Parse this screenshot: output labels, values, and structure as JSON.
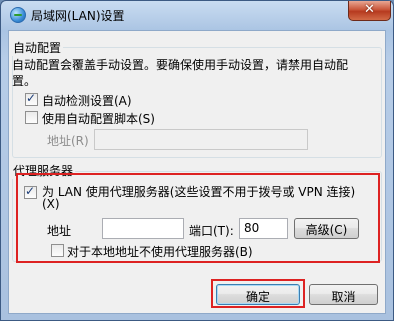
{
  "window": {
    "title": "局域网(LAN)设置",
    "close_label": "✕"
  },
  "auto_config": {
    "group_label": "自动配置",
    "description_line1": "自动配置会覆盖手动设置。要确保使用手动设置，请禁用自动配",
    "description_line2": "置。",
    "auto_detect_label": "自动检测设置(A)",
    "auto_detect_checked": true,
    "use_script_label": "使用自动配置脚本(S)",
    "use_script_checked": false,
    "address_label": "地址(R)",
    "address_value": ""
  },
  "proxy": {
    "group_label": "代理服务器",
    "use_proxy_label_line1": "为 LAN 使用代理服务器(这些设置不用于拨号或 VPN 连接)",
    "use_proxy_label_line2": "(X)",
    "use_proxy_checked": true,
    "address_label": "地址",
    "address_value": "",
    "port_label": "端口(T):",
    "port_value": "80",
    "advanced_label": "高级(C)",
    "bypass_local_label": "对于本地地址不使用代理服务器(B)",
    "bypass_local_checked": false
  },
  "buttons": {
    "ok_label": "确定",
    "cancel_label": "取消"
  }
}
